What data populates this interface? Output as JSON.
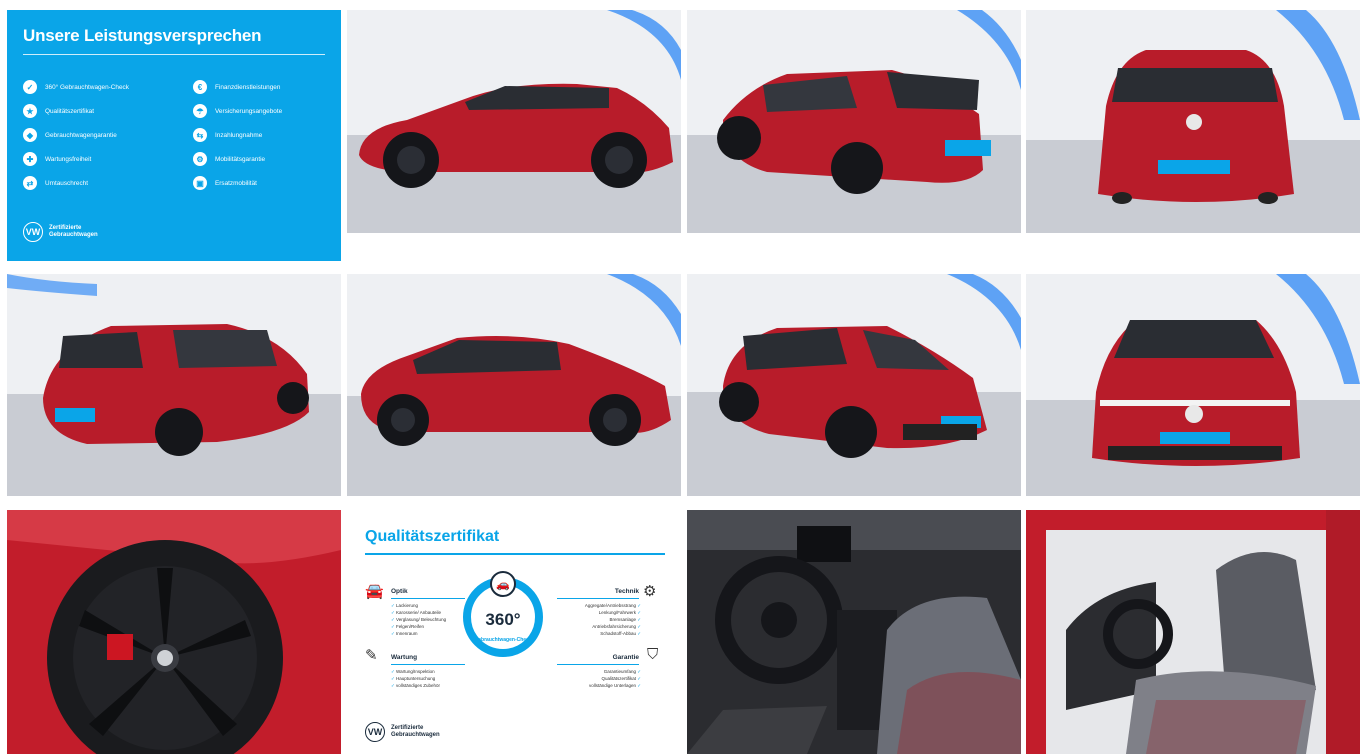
{
  "promise": {
    "title": "Unsere Leistungsversprechen",
    "left_items": [
      "360° Gebrauchtwagen-Check",
      "Qualitätszertifikat",
      "Gebrauchtwagengarantie",
      "Wartungsfreiheit",
      "Umtauschrecht"
    ],
    "right_items": [
      "Finanzdienstleistungen",
      "Versicherungsangebote",
      "Inzahlungnahme",
      "Mobilitätsgarantie",
      "Ersatzmobilität"
    ],
    "brand": "Zertifizierte Gebrauchtwagen"
  },
  "quality": {
    "title": "Qualitätszertifikat",
    "optik": {
      "label": "Optik",
      "items": [
        "Lackierung",
        "Karosserie/ Anbauteile",
        "Verglasung/ Beleuchtung",
        "Felgen/Reifen",
        "Innenraum"
      ]
    },
    "technik": {
      "label": "Technik",
      "items": [
        "Aggregate/Antriebsstrang",
        "Lenkung/Fahrwerk",
        "Bremsanlage",
        "Antriebsfahrsicherung",
        "Schadstoff-Abbau"
      ]
    },
    "wartung": {
      "label": "Wartung",
      "items": [
        "Wartung/Inspektion",
        "Hauptuntersuchung",
        "vollständiges Zubehör"
      ]
    },
    "garantie": {
      "label": "Garantie",
      "items": [
        "Garantieumfang",
        "Qualitätszertifikat",
        "vollständige Unterlagen"
      ]
    },
    "dial_number": "360°",
    "dial_text": "Gebrauchtwagen-Check",
    "brand": "Zertifizierte Gebrauchtwagen"
  },
  "photos": [
    {
      "name": "photo-side-left",
      "view": "side-left"
    },
    {
      "name": "photo-rear-three-quarter-left",
      "view": "rear-34-left"
    },
    {
      "name": "photo-rear",
      "view": "rear"
    },
    {
      "name": "photo-rear-three-quarter-right",
      "view": "rear-34-right"
    },
    {
      "name": "photo-side-right",
      "view": "side-right"
    },
    {
      "name": "photo-front-three-quarter",
      "view": "front-34"
    },
    {
      "name": "photo-front",
      "view": "front"
    },
    {
      "name": "photo-wheel",
      "view": "wheel"
    },
    {
      "name": "photo-cockpit",
      "view": "cockpit"
    },
    {
      "name": "photo-seats",
      "view": "seats"
    }
  ],
  "colors": {
    "accent": "#0aa5e8",
    "car_red": "#b81c2a",
    "studio_wall": "#eef0f3",
    "floor": "#c9ccd3"
  }
}
